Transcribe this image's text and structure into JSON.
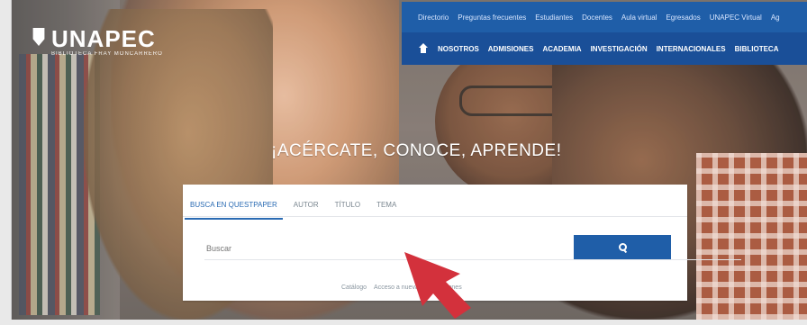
{
  "brand": {
    "name": "UNAPEC",
    "subtitle": "BIBLIOTECA FRAY MONCARRERO"
  },
  "topbar": {
    "links": [
      "Directorio",
      "Preguntas frecuentes",
      "Estudiantes",
      "Docentes",
      "Aula virtual",
      "Egresados",
      "UNAPEC Virtual",
      "Ag"
    ]
  },
  "navbar": {
    "links": [
      "NOSOTROS",
      "ADMISIONES",
      "ACADEMIA",
      "INVESTIGACIÓN",
      "INTERNACIONALES",
      "BIBLIOTECA"
    ]
  },
  "hero": {
    "heading": "¡ACÉRCATE, CONOCE, APRENDE!"
  },
  "search": {
    "tabs": [
      "BUSCA EN QUESTPAPER",
      "AUTOR",
      "TÍTULO",
      "TEMA"
    ],
    "placeholder": "Buscar",
    "button_icon": "search-icon",
    "footer": {
      "left": "Catálogo",
      "right": "Acceso a nuevas adquisiciones"
    }
  },
  "colors": {
    "primary": "#1f5ea8",
    "nav_dark": "#1a4f98",
    "arrow": "#d3313c"
  }
}
